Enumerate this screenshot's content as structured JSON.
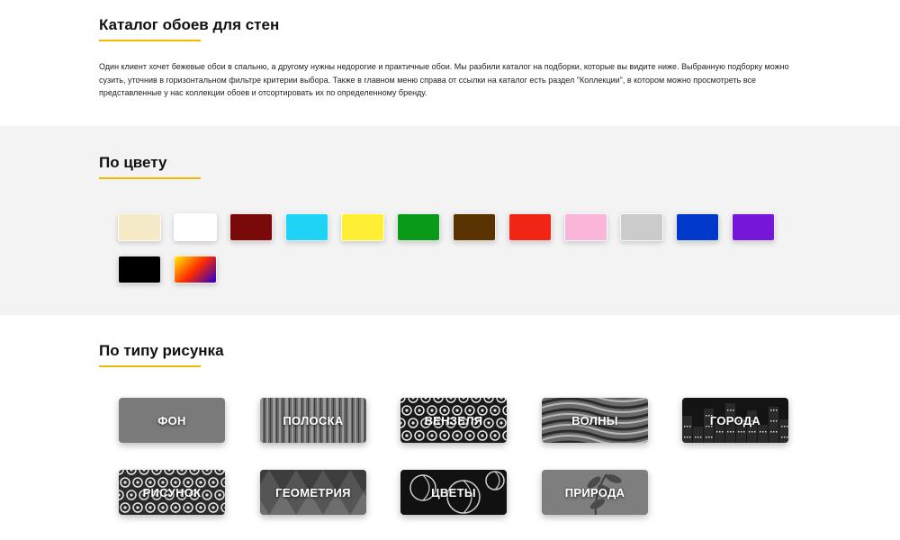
{
  "intro": {
    "title": "Каталог обоев для стен",
    "description": "Один клиент хочет бежевые обои в спальню, а другому нужны недорогие и практичные обои. Мы разбили каталог на подборки, которые вы видите ниже. Выбранную подборку можно сузить, уточнив в горизонтальном фильтре критерии выбора. Также в главном меню справа от ссылки на каталог есть раздел \"Коллекции\", в котором можно просмотреть все представленные у нас коллекции обоев и отсортировать их по определенному бренду."
  },
  "colors": {
    "title": "По цвету",
    "swatches": [
      {
        "name": "beige",
        "color": "#f5e9c8"
      },
      {
        "name": "white",
        "color": "#ffffff"
      },
      {
        "name": "burgundy",
        "color": "#7a0a0a"
      },
      {
        "name": "light-blue",
        "color": "#1ed3f5"
      },
      {
        "name": "yellow",
        "color": "#ffee33"
      },
      {
        "name": "green",
        "color": "#0a9a1a"
      },
      {
        "name": "brown",
        "color": "#5a3200"
      },
      {
        "name": "red",
        "color": "#f02515"
      },
      {
        "name": "pink",
        "color": "#f9b6d9"
      },
      {
        "name": "gray",
        "color": "#cbcbcb"
      },
      {
        "name": "blue",
        "color": "#0039c9"
      },
      {
        "name": "violet",
        "color": "#7417d8"
      },
      {
        "name": "black",
        "color": "#000000"
      },
      {
        "name": "multicolor",
        "gradient": [
          "#ffee00",
          "#ff2a00",
          "#2200cc"
        ]
      }
    ]
  },
  "patterns": {
    "title": "По типу рисунка",
    "tiles": [
      {
        "name": "fon",
        "label": "ФОН",
        "texture": "plain",
        "bg": "#7a7a7a"
      },
      {
        "name": "poloska",
        "label": "ПОЛОСКА",
        "texture": "stripes",
        "bg": "#6a6a6a"
      },
      {
        "name": "venzelya",
        "label": "ВЕНЗЕЛЯ",
        "texture": "damask",
        "bg": "#1a1a1a"
      },
      {
        "name": "volny",
        "label": "ВОЛНЫ",
        "texture": "waves",
        "bg": "#6a6a6a"
      },
      {
        "name": "goroda",
        "label": "ГОРОДА",
        "texture": "city",
        "bg": "#141414"
      },
      {
        "name": "risunok",
        "label": "РИСУНОК",
        "texture": "flowers",
        "bg": "#2a2a2a"
      },
      {
        "name": "geometriya",
        "label": "ГЕОМЕТРИЯ",
        "texture": "geometry",
        "bg": "#555555"
      },
      {
        "name": "cvety",
        "label": "ЦВЕТЫ",
        "texture": "bigflowers",
        "bg": "#111111"
      },
      {
        "name": "priroda",
        "label": "ПРИРОДА",
        "texture": "leaves",
        "bg": "#7e7e7e"
      }
    ]
  }
}
